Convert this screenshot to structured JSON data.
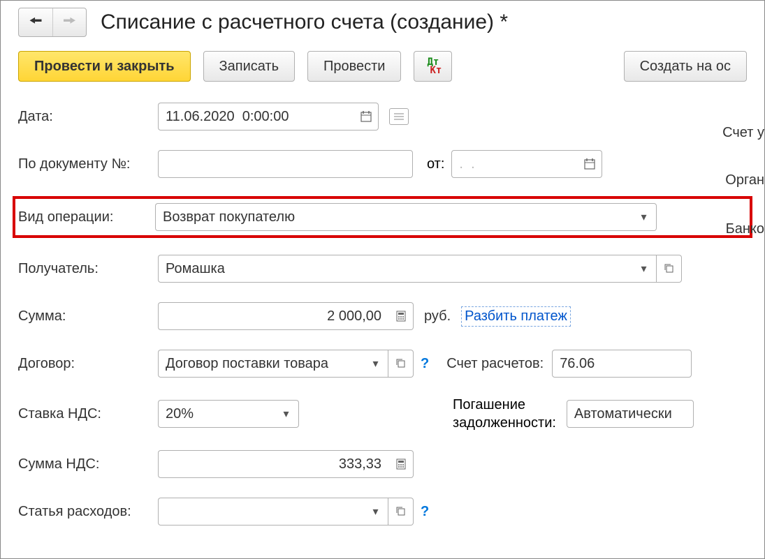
{
  "title": "Списание с расчетного счета (создание) *",
  "toolbar": {
    "post_close": "Провести и закрыть",
    "save": "Записать",
    "post": "Провести",
    "create_based": "Создать на ос"
  },
  "labels": {
    "date": "Дата:",
    "doc_no": "По документу №:",
    "from": "от:",
    "op_type": "Вид операции:",
    "recipient": "Получатель:",
    "amount": "Сумма:",
    "contract": "Договор:",
    "vat_rate": "Ставка НДС:",
    "vat_amount": "Сумма НДС:",
    "expense_item": "Статья расходов:",
    "currency": "руб.",
    "split": "Разбить платеж",
    "settlement_acc": "Счет расчетов:",
    "debt_repay1": "Погашение",
    "debt_repay2": "задолженности:",
    "account_rhs": "Счет у",
    "org_rhs": "Орган",
    "bank_rhs": "Банко"
  },
  "values": {
    "date": "11.06.2020  0:00:00",
    "doc_no": "",
    "doc_from": ".  .",
    "op_type": "Возврат покупателю",
    "recipient": "Ромашка",
    "amount": "2 000,00",
    "contract": "Договор поставки товара",
    "vat_rate": "20%",
    "vat_amount": "333,33",
    "expense_item": "",
    "settlement_acc": "76.06",
    "debt_repay": "Автоматически"
  }
}
